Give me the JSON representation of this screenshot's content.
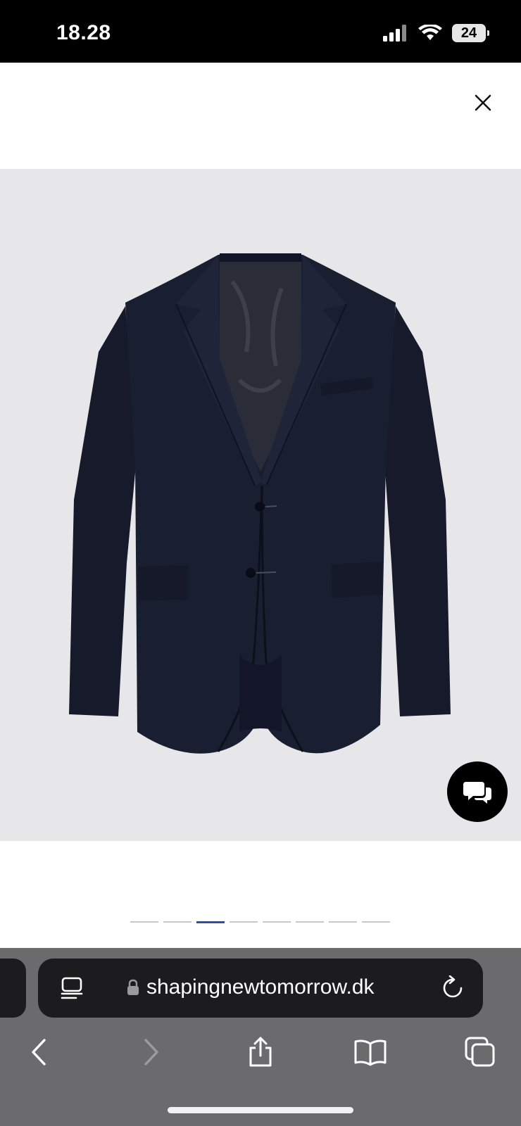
{
  "status_bar": {
    "time": "18.28",
    "battery_level": "24"
  },
  "header": {
    "close_icon": "close-icon"
  },
  "product": {
    "image_subject": "navy two-button suit blazer",
    "pager_total": 8,
    "pager_active_index": 2
  },
  "chat": {
    "icon": "chat-bubbles-icon"
  },
  "browser": {
    "url": "shapingnewtomorrow.dk",
    "icons": [
      "reader-icon",
      "lock-icon",
      "reload-icon",
      "back-icon",
      "forward-icon",
      "share-icon",
      "bookmarks-icon",
      "tabs-icon"
    ]
  },
  "colors": {
    "status_bg": "#000000",
    "product_bg": "#e7e7e9",
    "jacket": "#181c2e",
    "pager_active": "#2b4fa8",
    "browser_bg": "#6b6b6d",
    "url_pill": "#1c1c1e"
  }
}
